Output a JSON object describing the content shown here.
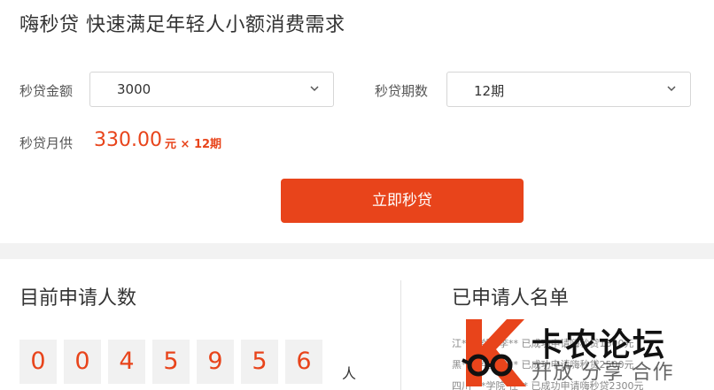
{
  "headline": "嗨秒贷 快速满足年轻人小额消费需求",
  "amount": {
    "label": "秒贷金额",
    "value": "3000"
  },
  "term": {
    "label": "秒贷期数",
    "value": "12期"
  },
  "monthly": {
    "label": "秒贷月供",
    "value": "330.00",
    "suffix": "元 × 12期"
  },
  "apply_button": "立即秒贷",
  "applicants_count": {
    "title": "目前申请人数",
    "digits": [
      "0",
      "0",
      "4",
      "5",
      "9",
      "5",
      "6"
    ],
    "unit": "人"
  },
  "applicant_list": {
    "title": "已申请人名单",
    "rows": [
      "江***学院 李** 已成功申请嗨秒贷1800元",
      "黑***学院 汪** 已成功申请嗨秒贷2500元",
      "四川***学院 任** 已成功申请嗨秒贷2300元"
    ]
  },
  "watermark": {
    "logo_letter": "K",
    "line1": "卡农论坛",
    "line2": "开放 分享 合作"
  },
  "colors": {
    "accent": "#e8441b",
    "panel_bg": "#ffffff",
    "page_bg": "#f2f2f2"
  },
  "icons": {
    "dropdown": "chevron-down-icon"
  }
}
